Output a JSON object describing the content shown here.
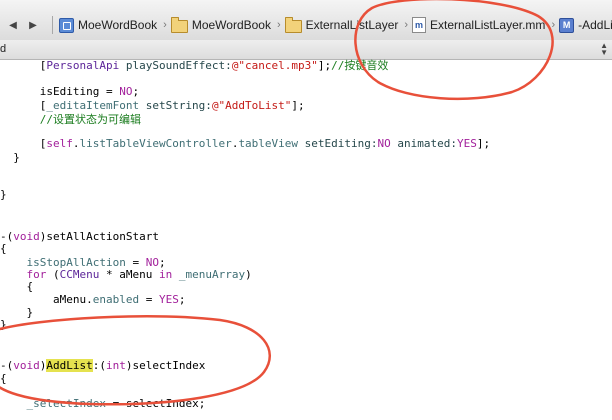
{
  "jumpbar": {
    "crumbs": [
      {
        "label": "MoeWordBook",
        "icon": "project-icon"
      },
      {
        "label": "MoeWordBook",
        "icon": "folder-icon"
      },
      {
        "label": "ExternalListLayer",
        "icon": "folder-icon"
      },
      {
        "label": "ExternalListLayer.mm",
        "icon": "source-file-icon"
      },
      {
        "label": "-AddList:",
        "icon": "method-icon"
      }
    ]
  },
  "subbar": {
    "label": "d"
  },
  "code": {
    "l1": {
      "pre": "      [",
      "a": "PersonalApi",
      "b": " playSoundEffect:",
      "c": "@\"cancel.mp3\"",
      "d": "];",
      "e": "//按键音效"
    },
    "l2": {
      "pre": "      isEditing = ",
      "a": "NO",
      "b": ";"
    },
    "l3": {
      "pre": "      [",
      "a": "_editaItemFont",
      "b": " setString:",
      "c": "@\"AddToList\"",
      "d": "];"
    },
    "l4": {
      "a": "      //设置状态为可编辑"
    },
    "l5": {
      "pre": "      [",
      "a": "self",
      "b": ".",
      "c": "listTableViewController",
      "d": ".",
      "e": "tableView",
      "f": " setEditing:",
      "g": "NO",
      "h": " animated:",
      "i": "YES",
      "j": "];"
    },
    "l6": {
      "a": "  }"
    },
    "l7": {
      "a": "}"
    },
    "l8": {
      "pre": "-(",
      "a": "void",
      "b": ")setAllActionStart"
    },
    "l9": {
      "a": "{"
    },
    "l10": {
      "pre": "    ",
      "a": "isStopAllAction",
      "b": " = ",
      "c": "NO",
      "d": ";"
    },
    "l11": {
      "pre": "    ",
      "a": "for",
      "b": " (",
      "c": "CCMenu",
      "d": " * aMenu ",
      "e": "in",
      "f": " ",
      "g": "_menuArray",
      "h": ")"
    },
    "l12": {
      "a": "    {"
    },
    "l13": {
      "pre": "        aMenu.",
      "a": "enabled",
      "b": " = ",
      "c": "YES",
      "d": ";"
    },
    "l14": {
      "a": "    }"
    },
    "l15": {
      "a": "}"
    },
    "l16": {
      "pre": "-(",
      "a": "void",
      "b": ")",
      "c": "AddList",
      "d": ":(",
      "e": "int",
      "f": ")selectIndex"
    },
    "l17": {
      "a": "{"
    },
    "l18": {
      "pre": "    ",
      "a": "_selectIndex",
      "b": " = selectIndex;"
    }
  },
  "colors": {
    "annotation": "#e8503a",
    "keyword": "#a2209b",
    "string": "#c41a16",
    "comment": "#1a7c1e",
    "highlight": "#e5e24f"
  }
}
